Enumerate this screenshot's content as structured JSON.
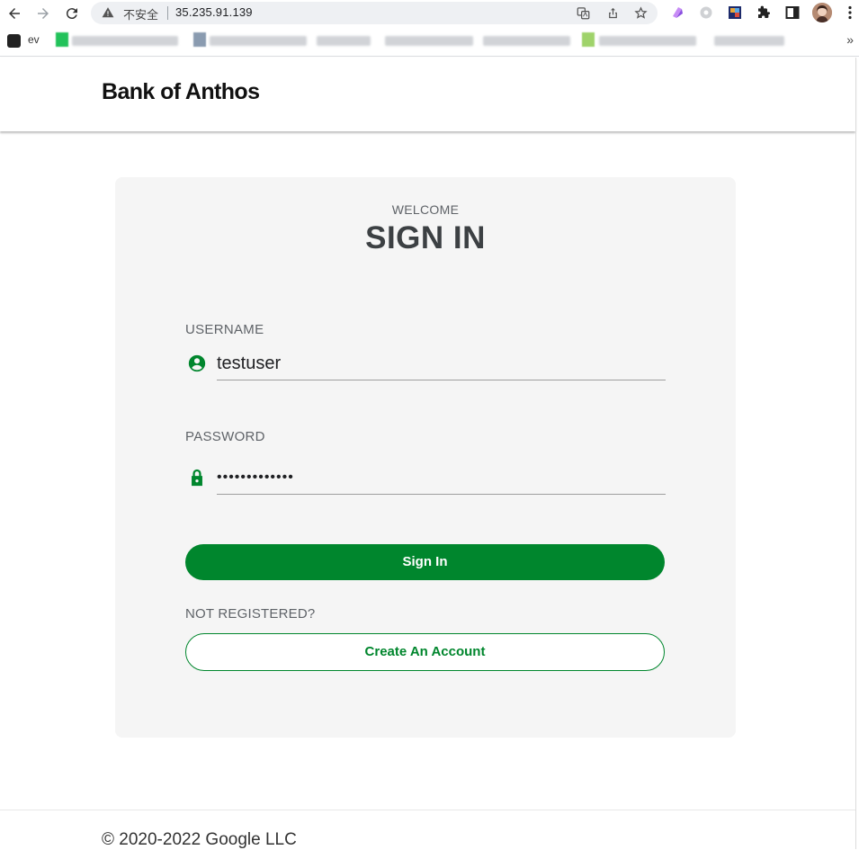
{
  "browser": {
    "insecure_label": "不安全",
    "url": "35.235.91.139",
    "bookmarks": {
      "first_label": "ev",
      "overflow": "»"
    }
  },
  "colors": {
    "accent": "#00862d",
    "card_bg": "#f5f5f5"
  },
  "app": {
    "brand": "Bank of Anthos"
  },
  "signin": {
    "welcome": "WELCOME",
    "title": "SIGN IN",
    "username_label": "USERNAME",
    "username_value": "testuser",
    "password_label": "PASSWORD",
    "password_value": "•••••••••••••",
    "submit": "Sign In",
    "not_registered": "NOT REGISTERED?",
    "create_account": "Create An Account"
  },
  "footer": {
    "copyright": "© 2020-2022 Google LLC"
  }
}
